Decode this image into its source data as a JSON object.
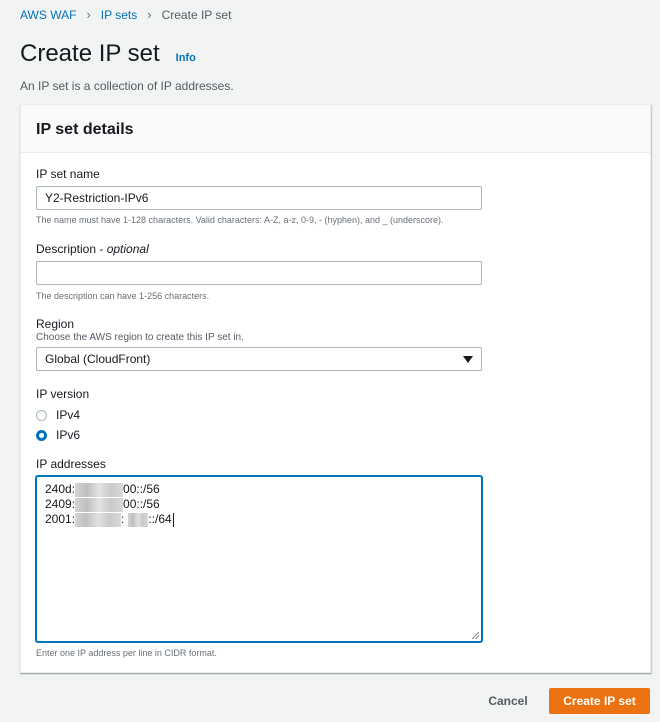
{
  "breadcrumb": {
    "items": [
      {
        "label": "AWS WAF"
      },
      {
        "label": "IP sets"
      },
      {
        "label": "Create IP set"
      }
    ]
  },
  "page": {
    "title": "Create IP set",
    "info_link": "Info",
    "description": "An IP set is a collection of IP addresses."
  },
  "panel": {
    "title": "IP set details",
    "name_field": {
      "label": "IP set name",
      "value": "Y2-Restriction-IPv6",
      "hint": "The name must have 1-128 characters. Valid characters: A-Z, a-z, 0-9, - (hyphen), and _ (underscore)."
    },
    "description_field": {
      "label": "Description",
      "label_optional": "optional",
      "value": "",
      "hint": "The description can have 1-256 characters."
    },
    "region_field": {
      "label": "Region",
      "sublabel": "Choose the AWS region to create this IP set in.",
      "selected": "Global (CloudFront)"
    },
    "ip_version": {
      "label": "IP version",
      "options": [
        {
          "label": "IPv4",
          "checked": false
        },
        {
          "label": "IPv6",
          "checked": true
        }
      ]
    },
    "ip_addresses": {
      "label": "IP addresses",
      "lines": [
        {
          "prefix": "240d:",
          "suffix": "00::/56"
        },
        {
          "prefix": "2409:",
          "suffix": "00::/56"
        },
        {
          "prefix": "2001:",
          "mid": ":",
          "suffix": "::/64"
        }
      ],
      "hint": "Enter one IP address per line in CIDR format."
    }
  },
  "actions": {
    "cancel": "Cancel",
    "submit": "Create IP set"
  },
  "colors": {
    "link": "#0073bb",
    "primary": "#ec7211",
    "background": "#f2f3f3"
  }
}
